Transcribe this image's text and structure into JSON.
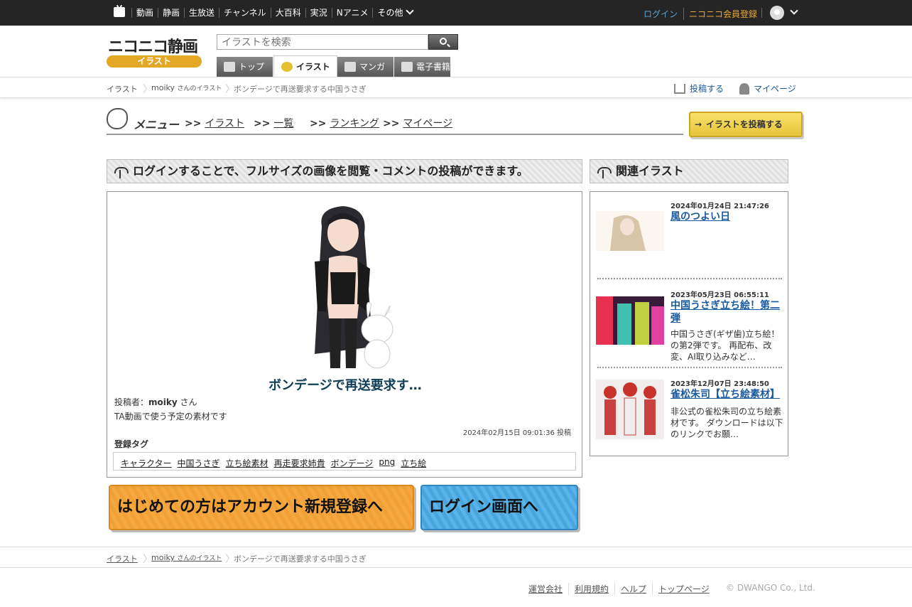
{
  "topbar": {
    "nav": [
      "動画",
      "静画",
      "生放送",
      "チャンネル",
      "大百科",
      "実況",
      "Nアニメ",
      "その他"
    ],
    "login": "ログイン",
    "register": "ニコニコ会員登録"
  },
  "logo": {
    "text": "ニコニコ静画",
    "sub": "イラスト"
  },
  "search": {
    "placeholder": "イラストを検索"
  },
  "tabs": [
    "トップ",
    "イラスト",
    "マンガ",
    "電子書籍"
  ],
  "breadcrumb": {
    "root": "イラスト",
    "user": "moiky",
    "user_suffix": "さんのイラスト",
    "current": "ボンデージで再送要求する中国うさぎ",
    "post": "投稿する",
    "mypage": "マイページ"
  },
  "menu": {
    "title": "メニュー",
    "items": [
      "イラスト",
      "一覧",
      "ランキング",
      "マイページ"
    ],
    "prefix": ">>",
    "cta": "イラストを投稿する"
  },
  "left_head": "ログインすることで、フルサイズの画像を閲覧・コメントの投稿ができます。",
  "illust": {
    "title": "ボンデージで再送要求す…",
    "poster_label": "投稿者：",
    "poster": "moiky",
    "poster_suffix": " さん",
    "description": "TA動画で使う予定の素材です",
    "posted": "2024年02月15日 09:01:36 投稿",
    "tags_heading": "登録タグ",
    "tags": [
      "キャラクター",
      "中国うさぎ",
      "立ち絵素材",
      "再走要求姉貴",
      "ボンデージ",
      "png",
      "立ち絵"
    ]
  },
  "banners": {
    "register": "はじめての方はアカウント新規登録へ",
    "login": "ログイン画面へ"
  },
  "related": {
    "heading": "関連イラスト",
    "items": [
      {
        "date": "2024年01月24日 21:47:26",
        "title": "風のつよい日",
        "desc": ""
      },
      {
        "date": "2023年05月23日 06:55:11",
        "title": "中国うさぎ立ち絵！第二弾",
        "desc": "中国うさぎ(ギザ歯)立ち絵！の第2弾です。 再配布、改変、AI取り込みなど…"
      },
      {
        "date": "2023年12月07日 23:48:50",
        "title": "雀松朱司【立ち絵素材】",
        "desc": "非公式の雀松朱司の立ち絵素材です。 ダウンロードは以下のリンクでお願…"
      }
    ]
  },
  "footer": {
    "links": [
      "運営会社",
      "利用規約",
      "ヘルプ",
      "トップページ"
    ],
    "copyright": "© DWANGO Co., Ltd."
  }
}
